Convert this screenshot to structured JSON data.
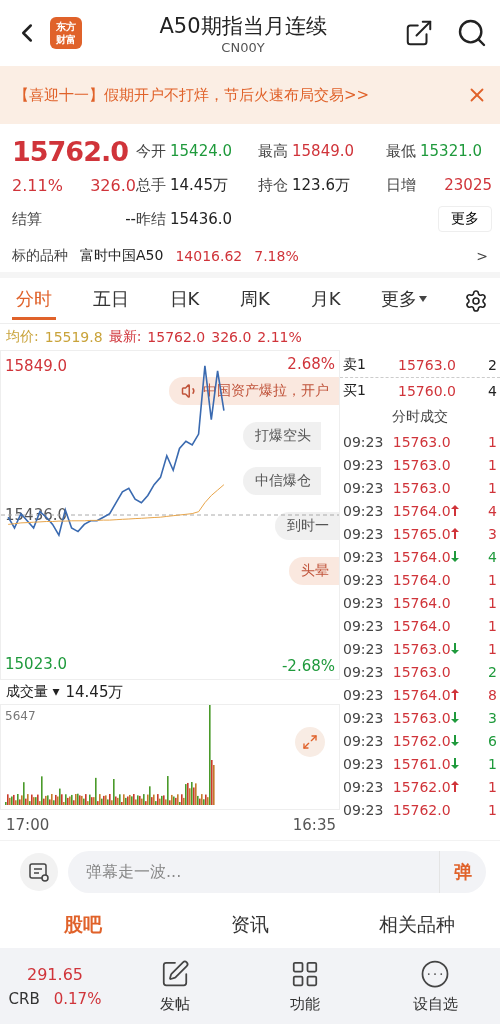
{
  "header": {
    "logo": [
      "东方",
      "财富"
    ],
    "title": "A50期指当月连续",
    "code": "CN00Y"
  },
  "banner": {
    "text": "【喜迎十一】假期开户不打烊，节后火速布局交易>>"
  },
  "quote": {
    "price": "15762.0",
    "pct": "2.11%",
    "change": "326.0",
    "settle_label": "结算",
    "settle_value": "--",
    "stats": [
      {
        "label": "今开",
        "value": "15424.0",
        "color": "#1f9a3c"
      },
      {
        "label": "最高",
        "value": "15849.0",
        "color": "#d0343a"
      },
      {
        "label": "最低",
        "value": "15321.0",
        "color": "#1f9a3c"
      },
      {
        "label": "总手",
        "value": "14.45万",
        "color": "#222222"
      },
      {
        "label": "持仓",
        "value": "123.6万",
        "color": "#222222"
      },
      {
        "label": "日增",
        "value": "23025",
        "color": "#d0343a"
      },
      {
        "label": "昨结",
        "value": "15436.0",
        "color": "#222222"
      }
    ],
    "more": "更多"
  },
  "underlying": {
    "label": "标的品种",
    "name": "富时中国A50",
    "value": "14016.62",
    "pct": "7.18%",
    "arrow": ">"
  },
  "tabs": [
    {
      "label": "分时",
      "selected": true
    },
    {
      "label": "五日",
      "selected": false
    },
    {
      "label": "日K",
      "selected": false
    },
    {
      "label": "周K",
      "selected": false
    },
    {
      "label": "月K",
      "selected": false
    },
    {
      "label": "更多",
      "selected": false
    }
  ],
  "info": {
    "avg_label": "均价:",
    "avg": "15519.8",
    "last_label": "最新:",
    "last": "15762.0",
    "change": "326.0",
    "pct": "2.11%"
  },
  "chart": {
    "high_pct": "2.68%",
    "low_pct": "-2.68%",
    "chart_data": {
      "type": "line",
      "categories": [
        null,
        null,
        null,
        null,
        null,
        null,
        null,
        null,
        null,
        null,
        null,
        null,
        null,
        null,
        null,
        null,
        null,
        null,
        null,
        null,
        null,
        null,
        null,
        null,
        null,
        null,
        null,
        null,
        null,
        null,
        null,
        null,
        null,
        null,
        null,
        null,
        null,
        null,
        null,
        null,
        null,
        null,
        null,
        null,
        null,
        null,
        null,
        null,
        null,
        null,
        null,
        null
      ],
      "ylim": [
        14982,
        15890
      ],
      "yticks": [
        {
          "value": 15849,
          "label": "15849.0"
        },
        {
          "value": 15436,
          "label": "15436.0"
        },
        {
          "value": 15023,
          "label": "15023.0"
        }
      ],
      "series": [
        {
          "color": "#3a6ab0",
          "values": [
            15430,
            15400,
            15440,
            15420,
            15400,
            15445,
            15430,
            15410,
            15380,
            15450,
            15400,
            15390,
            15410,
            15420,
            15420,
            15430,
            15440,
            15470,
            15500,
            15510,
            15480,
            15470,
            15490,
            15520,
            15540,
            15600,
            15560,
            15620,
            15640,
            15630,
            15660,
            15849,
            15700,
            15835,
            15725,
            null,
            null,
            null,
            null,
            null,
            null,
            null,
            null,
            null,
            null,
            null,
            null,
            null,
            null,
            null,
            null,
            null
          ]
        },
        {
          "color": "#e8a54a",
          "values": [
            15410,
            15412,
            15414,
            15415,
            15416,
            15417,
            15418,
            15418,
            15419,
            15419,
            15420,
            15420,
            15420,
            15421,
            15421,
            15422,
            15422,
            15423,
            15424,
            15425,
            15426,
            15427,
            15428,
            15429,
            15430,
            15432,
            15434,
            15436,
            15438,
            15440,
            15445,
            15470,
            15490,
            15505,
            15520,
            null,
            null,
            null,
            null,
            null,
            null,
            null,
            null,
            null,
            null,
            null,
            null,
            null,
            null,
            null,
            null,
            null
          ]
        }
      ]
    },
    "bullets": [
      {
        "text": "中国资产爆拉，开户",
        "kind": "speaker"
      },
      {
        "text": "打爆空头",
        "kind": "plain"
      },
      {
        "text": "中信爆仓",
        "kind": "plain"
      },
      {
        "text": "到时一",
        "kind": "plain"
      },
      {
        "text": "头晕",
        "kind": "hot"
      }
    ]
  },
  "volume": {
    "label": "成交量",
    "caret": "▾",
    "total": "14.45万",
    "max": "5647",
    "start": "17:00",
    "end": "16:35"
  },
  "book": {
    "ask_label": "卖1",
    "ask": "15763.0",
    "ask_qty": "2",
    "bid_label": "买1",
    "bid": "15760.0",
    "bid_qty": "4",
    "title": "分时成交",
    "trades": [
      {
        "time": "09:23",
        "price": "15763.0",
        "kind": "flat",
        "qty": "1",
        "color": "#d0343a"
      },
      {
        "time": "09:23",
        "price": "15763.0",
        "kind": "flat",
        "qty": "1",
        "color": "#d0343a"
      },
      {
        "time": "09:23",
        "price": "15763.0",
        "kind": "flat",
        "qty": "1",
        "color": "#d0343a"
      },
      {
        "time": "09:23",
        "price": "15764.0",
        "kind": "up",
        "qty": "4",
        "color": "#d0343a"
      },
      {
        "time": "09:23",
        "price": "15765.0",
        "kind": "up",
        "qty": "3",
        "color": "#d0343a"
      },
      {
        "time": "09:23",
        "price": "15764.0",
        "kind": "down",
        "qty": "4",
        "color": "#1f9a3c"
      },
      {
        "time": "09:23",
        "price": "15764.0",
        "kind": "flat",
        "qty": "1",
        "color": "#d0343a"
      },
      {
        "time": "09:23",
        "price": "15764.0",
        "kind": "flat",
        "qty": "1",
        "color": "#d0343a"
      },
      {
        "time": "09:23",
        "price": "15764.0",
        "kind": "flat",
        "qty": "1",
        "color": "#d0343a"
      },
      {
        "time": "09:23",
        "price": "15763.0",
        "kind": "down",
        "qty": "1",
        "color": "#d0343a"
      },
      {
        "time": "09:23",
        "price": "15763.0",
        "kind": "flat",
        "qty": "2",
        "color": "#1f9a3c"
      },
      {
        "time": "09:23",
        "price": "15764.0",
        "kind": "up",
        "qty": "8",
        "color": "#d0343a"
      },
      {
        "time": "09:23",
        "price": "15763.0",
        "kind": "down",
        "qty": "3",
        "color": "#1f9a3c"
      },
      {
        "time": "09:23",
        "price": "15762.0",
        "kind": "down",
        "qty": "6",
        "color": "#1f9a3c"
      },
      {
        "time": "09:23",
        "price": "15761.0",
        "kind": "down",
        "qty": "1",
        "color": "#1f9a3c"
      },
      {
        "time": "09:23",
        "price": "15762.0",
        "kind": "up",
        "qty": "1",
        "color": "#d0343a"
      },
      {
        "time": "09:23",
        "price": "15762.0",
        "kind": "flat",
        "qty": "1",
        "color": "#d0343a"
      }
    ]
  },
  "comment": {
    "placeholder": "弹幕走一波...",
    "send": "弹"
  },
  "section_tabs": [
    {
      "label": "股吧",
      "selected": true
    },
    {
      "label": "资讯",
      "selected": false
    },
    {
      "label": "相关品种",
      "selected": false
    }
  ],
  "bottom": {
    "ticker_value": "291.65",
    "ticker_name": "CRB",
    "ticker_pct": "0.17%",
    "actions": [
      {
        "label": "发帖",
        "kind": "post"
      },
      {
        "label": "功能",
        "kind": "apps"
      },
      {
        "label": "设自选",
        "kind": "more"
      }
    ]
  }
}
